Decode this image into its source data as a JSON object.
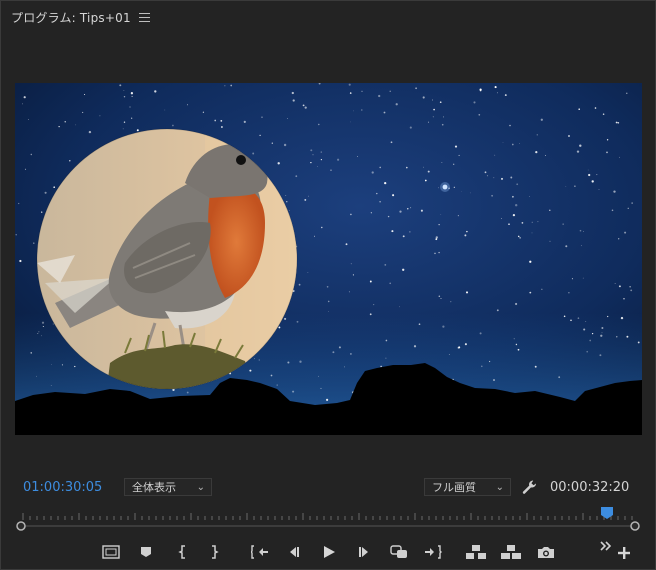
{
  "panel": {
    "title": "プログラム: Tips+01",
    "menu_icon": "hamburger-menu-icon"
  },
  "viewer": {
    "description_icons": [
      "sky-starfield",
      "bird-circle-overlay",
      "mountain-silhouette"
    ]
  },
  "timebar": {
    "current_timecode": "01:00:30:05",
    "zoom_label": "全体表示",
    "quality_label": "フル画質",
    "duration_timecode": "00:00:32:20",
    "accent_color": "#3d8de0"
  },
  "transport": {
    "buttons": [
      "safe-margins-icon",
      "add-marker-icon",
      "mark-in-icon",
      "mark-out-icon",
      "go-to-in-icon",
      "step-back-icon",
      "play-icon",
      "step-forward-icon",
      "go-to-out-icon",
      "lift-icon",
      "extract-icon",
      "export-frame-icon",
      "button-editor-icon"
    ]
  }
}
